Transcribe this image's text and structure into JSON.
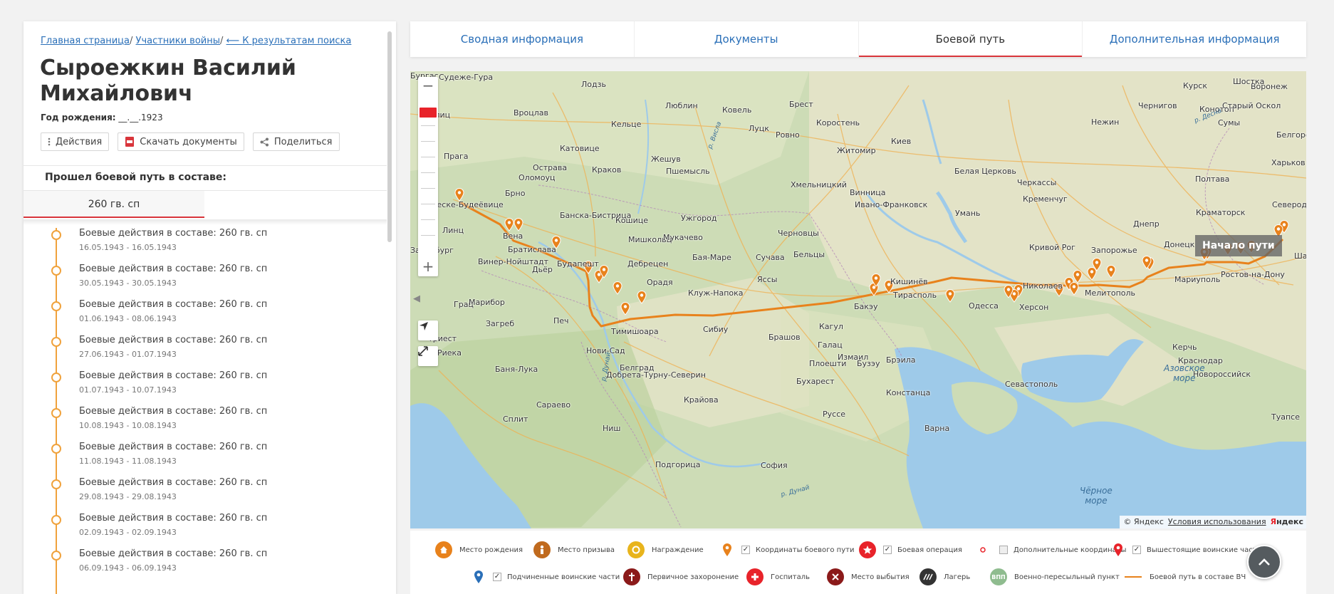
{
  "breadcrumb": {
    "home": "Главная страница",
    "participants": "Участники войны",
    "back": "⟵ К результатам поиска"
  },
  "person": {
    "name": "Сыроежкин Василий Михайлович",
    "birth_label": "Год рождения:",
    "birth_value": "__.__.1923"
  },
  "actions": {
    "actions_label": "Действия",
    "download_label": "Скачать документы",
    "share_label": "Поделиться"
  },
  "composition": {
    "title": "Прошел боевой путь в составе:",
    "unit_tab": "260 гв. сп"
  },
  "timeline": [
    {
      "title": "Боевые действия в составе: 260 гв. сп",
      "dates": "16.05.1943 - 16.05.1943"
    },
    {
      "title": "Боевые действия в составе: 260 гв. сп",
      "dates": "30.05.1943 - 30.05.1943"
    },
    {
      "title": "Боевые действия в составе: 260 гв. сп",
      "dates": "01.06.1943 - 08.06.1943"
    },
    {
      "title": "Боевые действия в составе: 260 гв. сп",
      "dates": "27.06.1943 - 01.07.1943"
    },
    {
      "title": "Боевые действия в составе: 260 гв. сп",
      "dates": "01.07.1943 - 10.07.1943"
    },
    {
      "title": "Боевые действия в составе: 260 гв. сп",
      "dates": "10.08.1943 - 10.08.1943"
    },
    {
      "title": "Боевые действия в составе: 260 гв. сп",
      "dates": "11.08.1943 - 11.08.1943"
    },
    {
      "title": "Боевые действия в составе: 260 гв. сп",
      "dates": "29.08.1943 - 29.08.1943"
    },
    {
      "title": "Боевые действия в составе: 260 гв. сп",
      "dates": "02.09.1943 - 02.09.1943"
    },
    {
      "title": "Боевые действия в составе: 260 гв. сп",
      "dates": "06.09.1943 - 06.09.1943"
    }
  ],
  "tabs": {
    "summary": "Сводная информация",
    "documents": "Документы",
    "battle_path": "Боевой путь",
    "additional": "Дополнительная информация"
  },
  "map": {
    "start_label": "Начало пути",
    "copyright": "© Яндекс",
    "terms": "Условия использования",
    "brand_first": "Я",
    "brand_rest": "ндекс",
    "route_color": "#e8821c",
    "water": {
      "azov": "Азовское\nморе",
      "black": "Чёрное\nморе"
    },
    "rivers": {
      "desna": "р. Десна",
      "vistula": "р. Висла",
      "danube1": "р. Дунай",
      "danube2": "р. Дунай"
    },
    "cities": [
      "Судеже-Гура",
      "Лодзь",
      "Люблин",
      "Ковель",
      "Брест",
      "Курск",
      "Воронеж",
      "Чернигов",
      "Конотоп",
      "Шостка",
      "Старый Оскол",
      "Гёрлиц",
      "Вроцлав",
      "Кельце",
      "Луцк",
      "Ровно",
      "Коростень",
      "Нежин",
      "Сумы",
      "Белгород",
      "Катовице",
      "Жешув",
      "Житомир",
      "Киев",
      "Прага",
      "Острава",
      "Краков",
      "Пшемысль",
      "Оломоуц",
      "Брно",
      "Белая Церковь",
      "Харьков",
      "Хмельницкий",
      "Черкассы",
      "Полтава",
      "Кременчуг",
      "Банска-Бистрица",
      "Ивано-Франковск",
      "Винница",
      "Ческе-Будеёвице",
      "Кошице",
      "Ужгород",
      "Умань",
      "Северодонецк",
      "Линц",
      "Вена",
      "Мишкольц",
      "Мукачево",
      "Черновцы",
      "Краматорск",
      "Днепр",
      "Братислава",
      "Кривой Рог",
      "Запорожье",
      "Донецк",
      "Зальцбург",
      "Будапешт",
      "Винер-Нойштадт",
      "Дебрецен",
      "Бая-Маре",
      "Сучава",
      "Бельцы",
      "Шахты",
      "Дьёр",
      "Мариуполь",
      "Ростов-на-Дону",
      "Орадя",
      "Клуж-Напока",
      "Яссы",
      "Кишинёв",
      "Николаев",
      "Мелитополь",
      "Грац",
      "Марибор",
      "Тирасполь",
      "Херсон",
      "Одесса",
      "Бакэу",
      "Печ",
      "Сибиу",
      "Брашов",
      "Загреб",
      "Тимишоара",
      "Кагул",
      "Галац",
      "Триест",
      "Нови-Сад",
      "Измаил",
      "Керчь",
      "Риека",
      "Белград",
      "Плоешти",
      "Бузэу",
      "Брэила",
      "Краснодар",
      "Баня-Лука",
      "Добрета-Турну-Северин",
      "Бухарест",
      "Констанца",
      "Новороссийск",
      "Крайова",
      "Севастополь",
      "Сараево",
      "Руссе",
      "Сплит",
      "Ниш",
      "Варна",
      "Туапсе",
      "Подгорица",
      "София",
      "Бургас"
    ]
  },
  "legend": {
    "items": [
      {
        "label": "Место рождения",
        "color": "#e8821c"
      },
      {
        "label": "Место призыва",
        "color": "#c06a1e"
      },
      {
        "label": "Награждение",
        "color": "#e8b41c"
      },
      {
        "label": "Координаты боевого пути",
        "color": "#e8821c"
      },
      {
        "label": "Боевая операция",
        "color": "#e8232a"
      },
      {
        "label": "Дополнительные координаты",
        "color": "#e8232a"
      },
      {
        "label": "Вышестоящие воинские части",
        "color": "#e8232a"
      },
      {
        "label": "Подчиненные воинские части",
        "color": "#2a6fb8"
      },
      {
        "label": "Первичное захоронение",
        "color": "#8b1a1a"
      },
      {
        "label": "Госпиталь",
        "color": "#e8232a"
      },
      {
        "label": "Место выбытия",
        "color": "#8b1a1a"
      },
      {
        "label": "Лагерь",
        "color": "#333333"
      },
      {
        "label": "Военно-пересыльный пункт",
        "color": "#8fbc8f",
        "badge": "ВПП"
      },
      {
        "label": "Боевой путь в составе ВЧ",
        "color": "#e8821c"
      }
    ]
  }
}
